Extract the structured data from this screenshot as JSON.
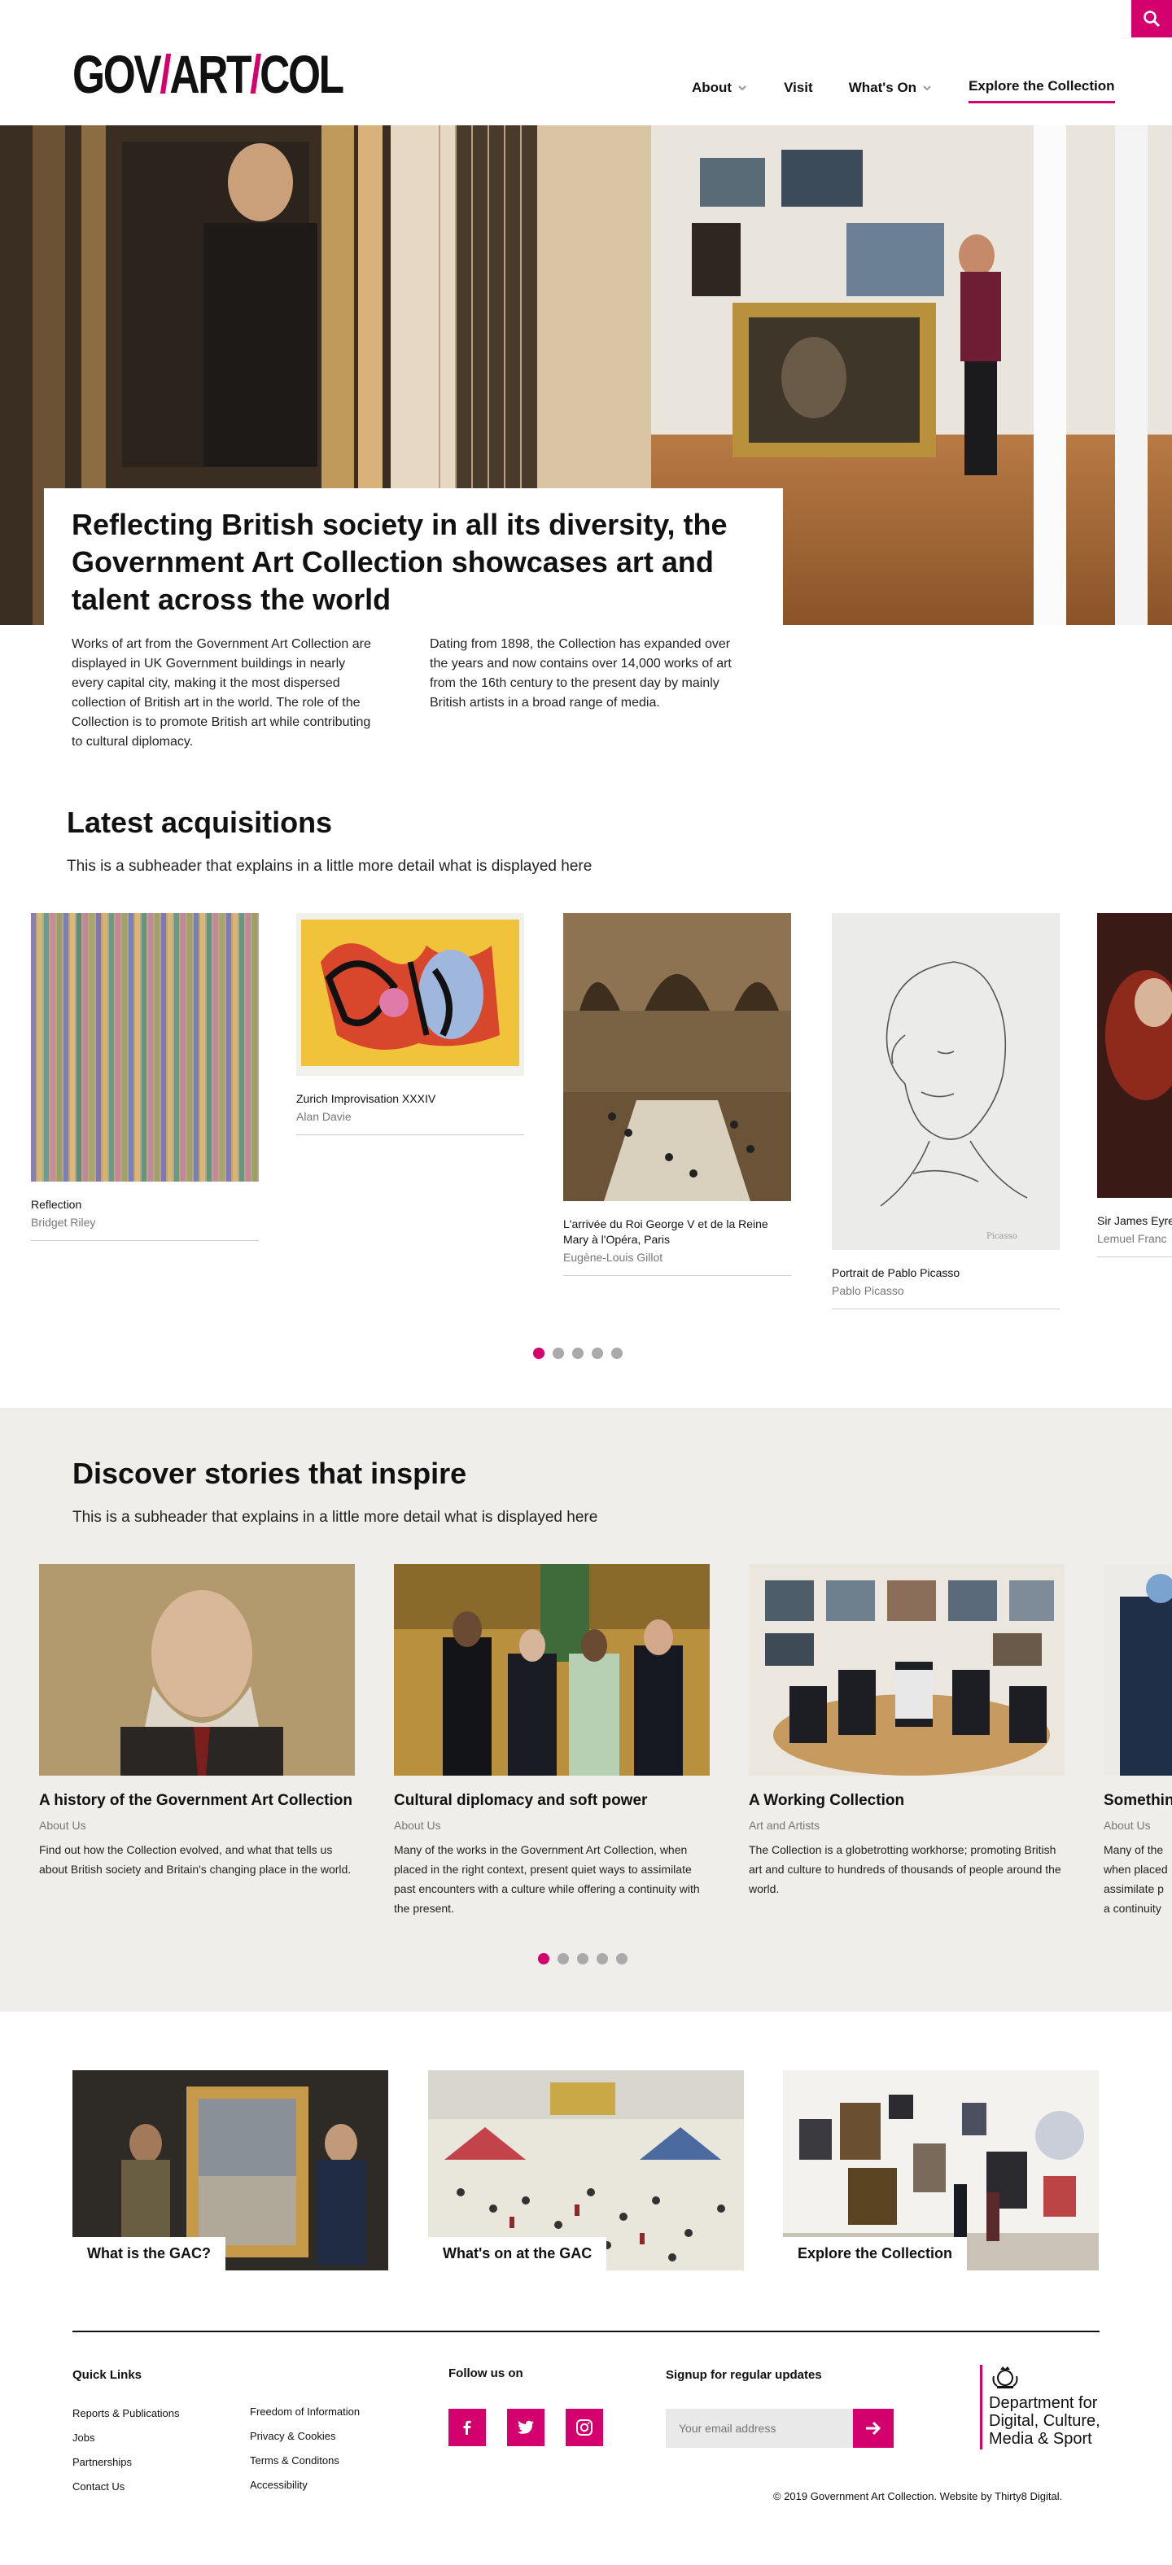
{
  "header": {
    "logo": {
      "part1": "GOV",
      "part2": "ART",
      "part3": "COL",
      "slash": "/"
    },
    "search_icon": "search-icon",
    "nav": [
      {
        "label": "About",
        "has_dropdown": true
      },
      {
        "label": "Visit",
        "has_dropdown": false
      },
      {
        "label": "What's On",
        "has_dropdown": true
      },
      {
        "label": "Explore the Collection",
        "has_dropdown": false,
        "active": true
      }
    ]
  },
  "hero": {
    "title": "Reflecting British society in all its diversity, the Government Art Collection showcases art and talent across the world",
    "col1": "Works of art from the Government Art Collection are displayed in UK Government buildings in nearly every capital city, making it the most dispersed collection of British art in the world. The role of the Collection is to promote British art while contributing to cultural diplomacy.",
    "col2": "Dating from 1898, the Collection has expanded over the years and now contains over 14,000 works of art from the 16th century to the present day by mainly British artists in a broad range of media."
  },
  "acquisitions": {
    "title": "Latest acquisitions",
    "subtitle": "This is a subheader that explains in a little more detail what is displayed here",
    "items": [
      {
        "title": "Reflection",
        "artist": "Bridget Riley"
      },
      {
        "title": "Zurich Improvisation XXXIV",
        "artist": "Alan Davie"
      },
      {
        "title": "L'arrivée du Roi George V et de la Reine Mary à l'Opéra, Paris",
        "artist": "Eugène-Louis Gillot"
      },
      {
        "title": "Portrait de Pablo Picasso",
        "artist": "Pablo Picasso"
      },
      {
        "title": "Sir James Eyre, Chief Justice of the",
        "artist": "Lemuel Franc"
      }
    ],
    "dots": 5,
    "active_dot": 0
  },
  "stories": {
    "title": "Discover stories that inspire",
    "subtitle": "This is a subheader that explains in a little more detail what is displayed here",
    "items": [
      {
        "title": "A history of the Government Art Collection",
        "category": "About Us",
        "text": "Find out how the Collection evolved, and what that tells us about British society and Britain's changing place in the world."
      },
      {
        "title": "Cultural diplomacy and soft power",
        "category": "About Us",
        "text": "Many of the works in the Government Art Collection, when placed in the right context, present quiet ways to assimilate past encounters with a culture while offering a continuity with the present."
      },
      {
        "title": "A Working Collection",
        "category": "Art and Artists",
        "text": "The Collection is a globetrotting workhorse; promoting British art and culture to hundreds of thousands of people around the world."
      },
      {
        "title": "Somethin",
        "category": "About Us",
        "text": "Many of the when placed assimilate p a continuity"
      }
    ],
    "dots": 5,
    "active_dot": 0
  },
  "promos": [
    {
      "label": "What is the GAC?"
    },
    {
      "label": "What's on at the GAC"
    },
    {
      "label": "Explore the Collection"
    }
  ],
  "footer": {
    "quick_links_title": "Quick Links",
    "links_col1": [
      "Reports & Publications",
      "Jobs",
      "Partnerships",
      "Contact Us"
    ],
    "links_col2": [
      "Freedom of Information",
      "Privacy & Cookies",
      "Terms & Conditons",
      "Accessibility"
    ],
    "follow_title": "Follow us on",
    "social": [
      "facebook-icon",
      "twitter-icon",
      "instagram-icon"
    ],
    "signup_title": "Signup for regular updates",
    "email_placeholder": "Your email address",
    "dcms": "Department for Digital, Culture, Media & Sport",
    "copyright": "© 2019 Government Art Collection. Website by Thirty8 Digital."
  },
  "colors": {
    "accent": "#d4006e",
    "stories_bg": "#efeeea"
  }
}
